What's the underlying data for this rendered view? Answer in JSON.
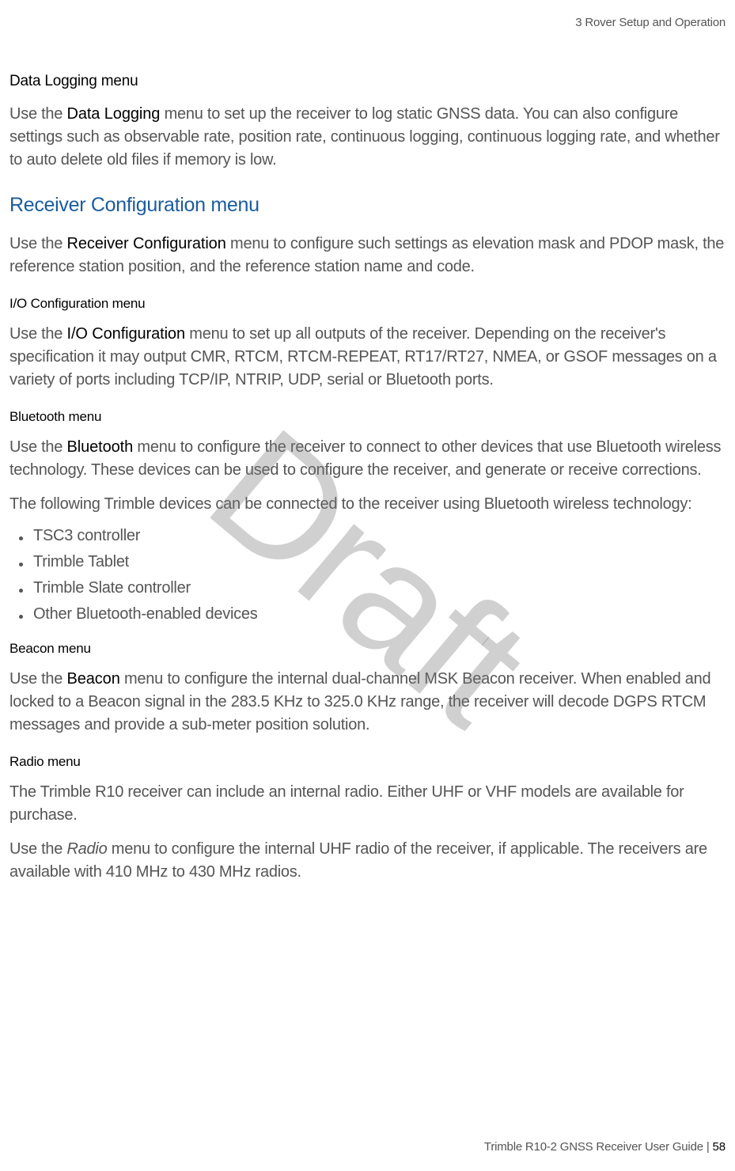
{
  "header": {
    "chapter": "3   Rover Setup and Operation"
  },
  "watermark": "Draft",
  "sections": {
    "data_logging": {
      "heading": "Data Logging menu",
      "para1_pre": "Use the ",
      "para1_bold": "Data Logging",
      "para1_post": " menu to set up the receiver to log static GNSS data. You can also configure settings such as observable rate, position rate, continuous logging, continuous logging rate, and whether to auto delete old files if memory is low."
    },
    "receiver_config": {
      "heading": "Receiver Configuration menu",
      "para1_pre": "Use the ",
      "para1_bold": "Receiver Configuration",
      "para1_post": " menu to configure such settings as elevation mask and PDOP mask, the reference station position, and the reference station name and code."
    },
    "io_config": {
      "heading": "I/O Configuration menu",
      "para1_pre": "Use the ",
      "para1_bold": "I/O Configuration",
      "para1_post": " menu to set up all outputs of the receiver. Depending on the receiver's specification it may output CMR, RTCM, RTCM-REPEAT, RT17/RT27, NMEA, or GSOF messages on a variety of ports including TCP/IP, NTRIP, UDP, serial or Bluetooth ports."
    },
    "bluetooth": {
      "heading": "Bluetooth menu",
      "para1_pre": "Use the ",
      "para1_bold": "Bluetooth",
      "para1_post": " menu to configure the receiver to connect to other devices that use Bluetooth wireless technology. These devices can be used to configure the receiver, and generate or receive corrections.",
      "para2": "The following Trimble devices can be connected to the receiver using Bluetooth wireless technology:",
      "list": [
        "TSC3 controller",
        "Trimble Tablet",
        "Trimble Slate controller",
        "Other Bluetooth-enabled devices"
      ]
    },
    "beacon": {
      "heading": "Beacon menu",
      "para1_pre": "Use the ",
      "para1_bold": "Beacon",
      "para1_post": " menu to configure the internal dual-channel MSK Beacon receiver. When enabled and locked to a Beacon signal in the 283.5 KHz to 325.0 KHz range, the receiver will decode DGPS RTCM messages and provide a sub-meter position solution."
    },
    "radio": {
      "heading": "Radio menu",
      "para1": "The Trimble R10 receiver can include an internal radio. Either UHF or VHF models are available for purchase.",
      "para2_pre": "Use the ",
      "para2_italic": "Radio",
      "para2_post": " menu to configure the internal UHF radio of the receiver, if applicable. The receivers are available with 410 MHz to 430 MHz radios."
    }
  },
  "footer": {
    "text_pre": "Trimble R10-2 GNSS Receiver User Guide | ",
    "page_num": "58"
  }
}
